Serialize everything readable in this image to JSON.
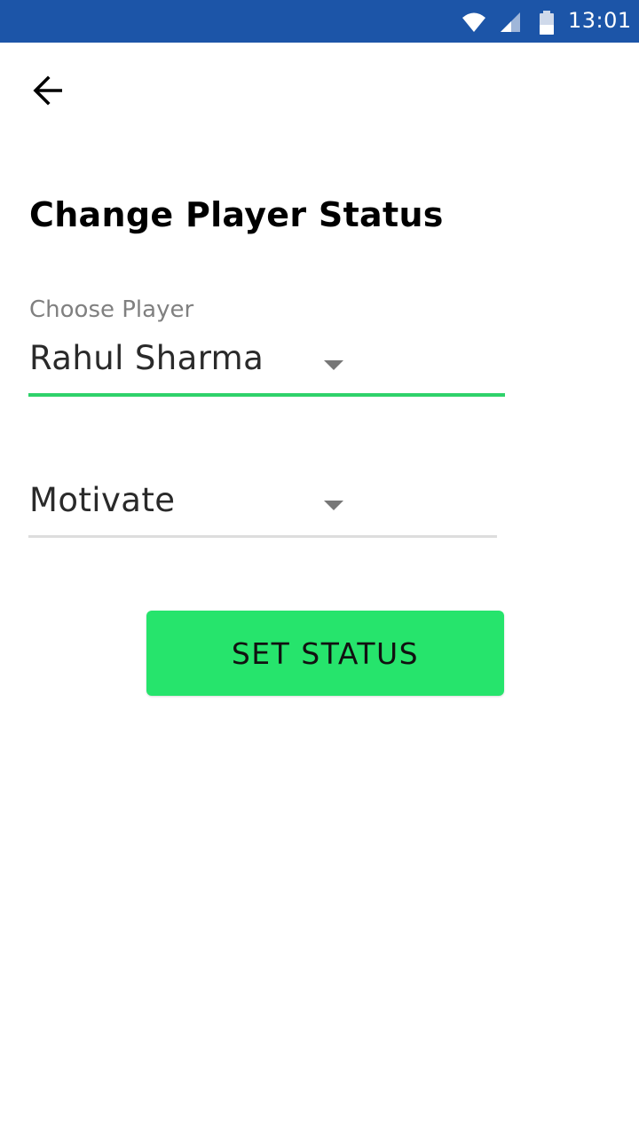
{
  "status_bar": {
    "time": "13:01",
    "icons": [
      "wifi-icon",
      "cell-signal-icon",
      "battery-icon"
    ],
    "background": "#1c55a8"
  },
  "header": {
    "back_icon": "arrow-left-icon",
    "title": "Change Player Status"
  },
  "player_field": {
    "label": "Choose Player",
    "value": "Rahul Sharma",
    "accent": "#2ed26a"
  },
  "status_field": {
    "value": "Motivate"
  },
  "actions": {
    "set_status_label": "SET STATUS",
    "button_color": "#26e46c"
  }
}
